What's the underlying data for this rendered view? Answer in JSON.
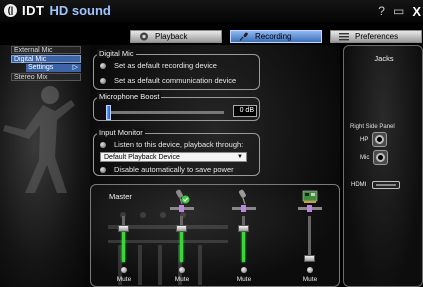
{
  "titlebar": {
    "logo_mark": "(|",
    "brand": "IDT",
    "product": "HD sound",
    "help": "?",
    "minimize": "▭",
    "close": "X"
  },
  "tabs": [
    {
      "label": "Playback",
      "active": false,
      "icon": "speaker-icon"
    },
    {
      "label": "Recording",
      "active": true,
      "icon": "microphone-icon"
    },
    {
      "label": "Preferences",
      "active": false,
      "icon": "list-icon"
    }
  ],
  "sidebar": {
    "items": [
      {
        "label": "External Mic",
        "selected": false
      },
      {
        "label": "Digital Mic",
        "selected": true
      },
      {
        "label": "Settings",
        "selected": true,
        "sub": true,
        "arrow": "▷"
      },
      {
        "label": "Stereo Mix",
        "selected": false
      }
    ]
  },
  "digital_mic": {
    "title": "Digital Mic",
    "options": [
      "Set as default recording device",
      "Set as default communication device"
    ]
  },
  "mic_boost": {
    "title": "Microphone Boost",
    "value_label": "0 dB",
    "level_fraction": 0.0
  },
  "input_monitor": {
    "title": "Input Monitor",
    "listen_label": "Listen to this device, playback through:",
    "device": "Default Playback Device",
    "disable_label": "Disable automatically to save power"
  },
  "mixer": {
    "master_label": "Master",
    "channels": [
      {
        "icon": "none",
        "level": 0.78,
        "fill": true,
        "mute": "Mute"
      },
      {
        "icon": "microphone-check-icon",
        "level": 0.78,
        "fill": true,
        "mute": "Mute"
      },
      {
        "icon": "microphone-icon",
        "level": 0.78,
        "fill": true,
        "mute": "Mute"
      },
      {
        "icon": "sound-card-icon",
        "level": 0.0,
        "fill": false,
        "mute": "Mute"
      }
    ]
  },
  "jacks": {
    "title": "Jacks",
    "panel_label": "Right Side Panel",
    "hp_label": "HP",
    "mic_label": "Mic",
    "hdmi_label": "HDMI"
  },
  "colors": {
    "accent": "#3c64a6",
    "level_green": "#2fdc2f"
  }
}
